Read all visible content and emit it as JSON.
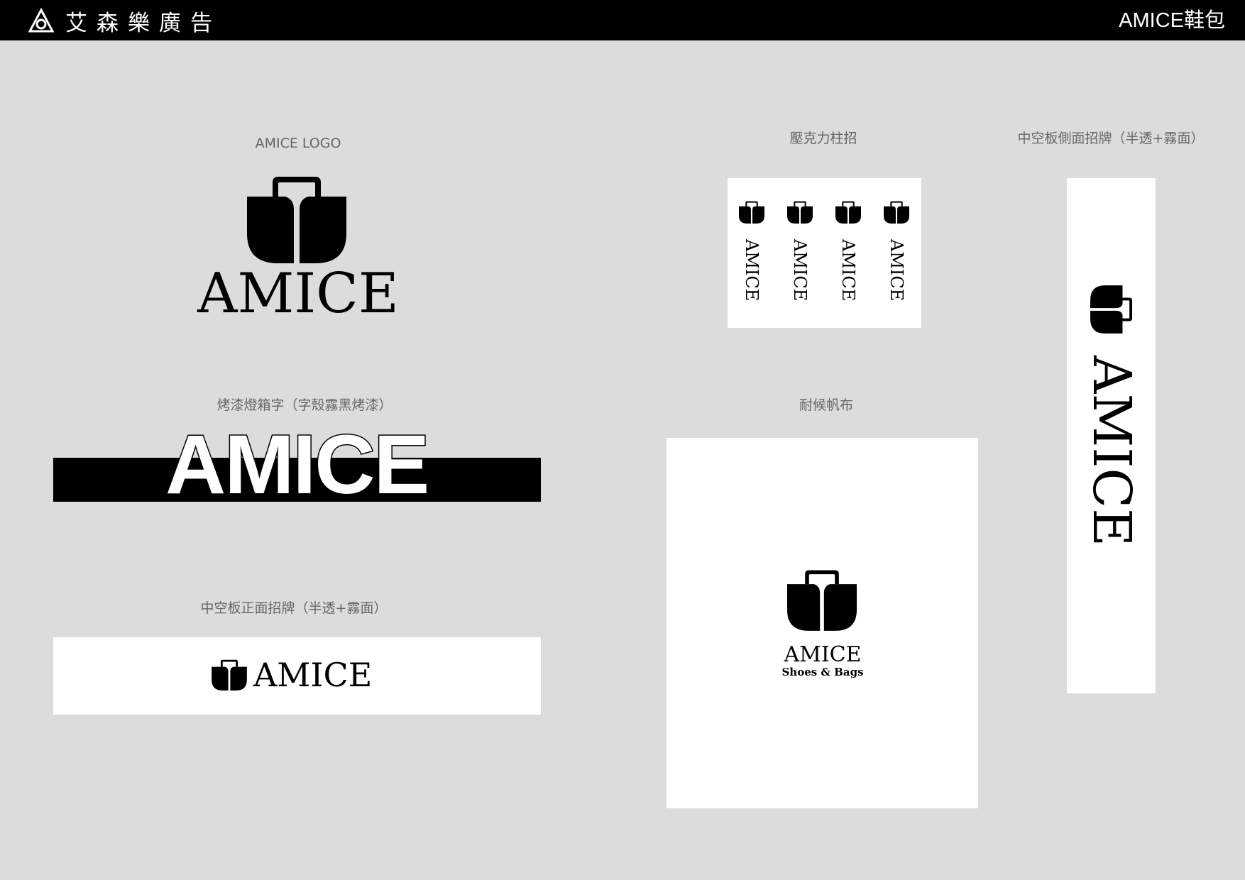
{
  "header": {
    "brand_name": "艾森樂廣告",
    "client_name": "AMICE鞋包"
  },
  "colors": {
    "bar": "#000000",
    "background": "#dcdcdc",
    "panel": "#ffffff",
    "label": "#666666"
  },
  "sections": {
    "logo": {
      "label": "AMICE LOGO",
      "wordmark": "AMICE"
    },
    "acrylic_column": {
      "label": "壓克力柱招",
      "column_text": "AMICE"
    },
    "side_sign": {
      "label": "中空板側面招牌（半透+霧面）",
      "wordmark": "AMICE"
    },
    "lightbox": {
      "label": "烤漆燈箱字（字殼霧黑烤漆）",
      "wordmark": "AMICE"
    },
    "canvas": {
      "label": "耐候帆布",
      "wordmark": "AMICE",
      "tagline": "Shoes & Bags"
    },
    "front_sign": {
      "label": "中空板正面招牌（半透+霧面）",
      "wordmark": "AMICE"
    }
  }
}
